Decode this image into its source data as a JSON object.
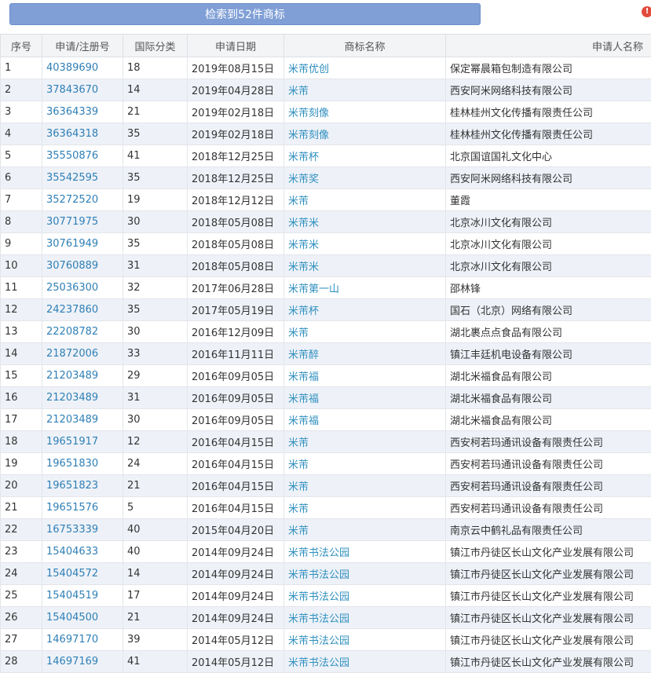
{
  "search_button": {
    "label": "检索到52件商标"
  },
  "table": {
    "headers": [
      "序号",
      "申请/注册号",
      "国际分类",
      "申请日期",
      "商标名称",
      "申请人名称"
    ],
    "rows": [
      [
        "1",
        "40389690",
        "18",
        "2019年08月15日",
        "米芾优创",
        "保定幂晨箱包制造有限公司"
      ],
      [
        "2",
        "37843670",
        "14",
        "2019年04月28日",
        "米芾",
        "西安阿米网络科技有限公司"
      ],
      [
        "3",
        "36364339",
        "21",
        "2019年02月18日",
        "米芾刻像",
        "桂林桂州文化传播有限责任公司"
      ],
      [
        "4",
        "36364318",
        "35",
        "2019年02月18日",
        "米芾刻像",
        "桂林桂州文化传播有限责任公司"
      ],
      [
        "5",
        "35550876",
        "41",
        "2018年12月25日",
        "米芾杯",
        "北京国谊国礼文化中心"
      ],
      [
        "6",
        "35542595",
        "35",
        "2018年12月25日",
        "米芾奖",
        "西安阿米网络科技有限公司"
      ],
      [
        "7",
        "35272520",
        "19",
        "2018年12月12日",
        "米芾",
        "董霞"
      ],
      [
        "8",
        "30771975",
        "30",
        "2018年05月08日",
        "米芾米",
        "北京冰川文化有限公司"
      ],
      [
        "9",
        "30761949",
        "35",
        "2018年05月08日",
        "米芾米",
        "北京冰川文化有限公司"
      ],
      [
        "10",
        "30760889",
        "31",
        "2018年05月08日",
        "米芾米",
        "北京冰川文化有限公司"
      ],
      [
        "11",
        "25036300",
        "32",
        "2017年06月28日",
        "米芾第一山",
        "邵林锋"
      ],
      [
        "12",
        "24237860",
        "35",
        "2017年05月19日",
        "米芾杯",
        "国石（北京）网络有限公司"
      ],
      [
        "13",
        "22208782",
        "30",
        "2016年12月09日",
        "米芾",
        "湖北裹点点食品有限公司"
      ],
      [
        "14",
        "21872006",
        "33",
        "2016年11月11日",
        "米芾醉",
        "镇江丰廷机电设备有限公司"
      ],
      [
        "15",
        "21203489",
        "29",
        "2016年09月05日",
        "米芾福",
        "湖北米福食品有限公司"
      ],
      [
        "16",
        "21203489",
        "31",
        "2016年09月05日",
        "米芾福",
        "湖北米福食品有限公司"
      ],
      [
        "17",
        "21203489",
        "30",
        "2016年09月05日",
        "米芾福",
        "湖北米福食品有限公司"
      ],
      [
        "18",
        "19651917",
        "12",
        "2016年04月15日",
        "米芾",
        "西安柯若玛通讯设备有限责任公司"
      ],
      [
        "19",
        "19651830",
        "24",
        "2016年04月15日",
        "米芾",
        "西安柯若玛通讯设备有限责任公司"
      ],
      [
        "20",
        "19651823",
        "21",
        "2016年04月15日",
        "米芾",
        "西安柯若玛通讯设备有限责任公司"
      ],
      [
        "21",
        "19651576",
        "5",
        "2016年04月15日",
        "米芾",
        "西安柯若玛通讯设备有限责任公司"
      ],
      [
        "22",
        "16753339",
        "40",
        "2015年04月20日",
        "米芾",
        "南京云中鹤礼品有限责任公司"
      ],
      [
        "23",
        "15404633",
        "40",
        "2014年09月24日",
        "米芾书法公园",
        "镇江市丹徒区长山文化产业发展有限公司"
      ],
      [
        "24",
        "15404572",
        "14",
        "2014年09月24日",
        "米芾书法公园",
        "镇江市丹徒区长山文化产业发展有限公司"
      ],
      [
        "25",
        "15404519",
        "17",
        "2014年09月24日",
        "米芾书法公园",
        "镇江市丹徒区长山文化产业发展有限公司"
      ],
      [
        "26",
        "15404500",
        "21",
        "2014年09月24日",
        "米芾书法公园",
        "镇江市丹徒区长山文化产业发展有限公司"
      ],
      [
        "27",
        "14697170",
        "39",
        "2014年05月12日",
        "米芾书法公园",
        "镇江市丹徒区长山文化产业发展有限公司"
      ],
      [
        "28",
        "14697169",
        "41",
        "2014年05月12日",
        "米芾书法公园",
        "镇江市丹徒区长山文化产业发展有限公司"
      ]
    ]
  },
  "colors": {
    "button_bg": "#7f9fd6",
    "link": "#2f7fb5",
    "header_bg": "#f3f4f6",
    "row_alt_bg": "#eef2f8"
  },
  "icons": {
    "corner": "alert-icon"
  }
}
